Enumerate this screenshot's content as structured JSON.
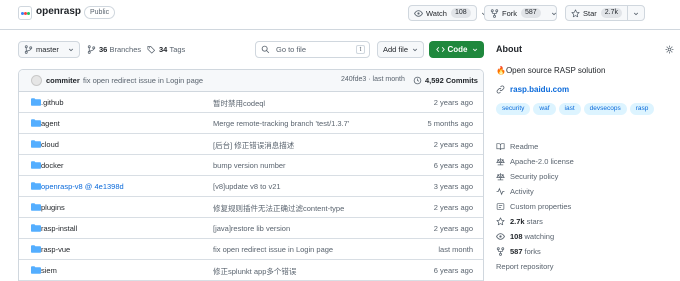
{
  "header": {
    "repo_name": "openrasp",
    "visibility": "Public",
    "watch_label": "Watch",
    "watch_count": "108",
    "fork_label": "Fork",
    "fork_count": "587",
    "star_label": "Star",
    "star_count": "2.7k"
  },
  "toolbar": {
    "branch": "master",
    "branches_count": "36",
    "branches_label": "Branches",
    "tags_count": "34",
    "tags_label": "Tags",
    "search_placeholder": "Go to file",
    "search_kbd": "t",
    "add_file_label": "Add file",
    "code_label": "Code"
  },
  "commit": {
    "author": "commiter",
    "message": "fix open redirect issue in Login page",
    "sha": "240fde3",
    "time": "last month",
    "count": "4,592 Commits"
  },
  "files": [
    {
      "name": ".github",
      "message": "暂时禁用codeql",
      "date": "2 years ago",
      "link": false
    },
    {
      "name": "agent",
      "message": "Merge remote-tracking branch 'test/1.3.7'",
      "date": "5 months ago",
      "link": false
    },
    {
      "name": "cloud",
      "message": "[后台] 修正错误消息描述",
      "date": "2 years ago",
      "link": false
    },
    {
      "name": "docker",
      "message": "bump version number",
      "date": "6 years ago",
      "link": false
    },
    {
      "name": "openrasp-v8 @ 4e1398d",
      "message": "[v8]update v8 to v21",
      "date": "3 years ago",
      "link": true
    },
    {
      "name": "plugins",
      "message": "修复规则插件无法正确过滤content-type",
      "date": "2 years ago",
      "link": false
    },
    {
      "name": "rasp-install",
      "message": "[java]restore lib version",
      "date": "2 years ago",
      "link": false
    },
    {
      "name": "rasp-vue",
      "message": "fix open redirect issue in Login page",
      "date": "last month",
      "link": false
    },
    {
      "name": "siem",
      "message": "修正splunkt app多个错误",
      "date": "6 years ago",
      "link": false
    }
  ],
  "sidebar": {
    "about_title": "About",
    "description": "🔥Open source RASP solution",
    "website": "rasp.baidu.com",
    "topics": [
      "security",
      "waf",
      "iast",
      "devsecops",
      "rasp"
    ],
    "readme": "Readme",
    "license": "Apache-2.0 license",
    "security_policy": "Security policy",
    "activity": "Activity",
    "custom_properties": "Custom properties",
    "stars_count": "2.7k",
    "stars_label": "stars",
    "watching_count": "108",
    "watching_label": "watching",
    "forks_count": "587",
    "forks_label": "forks",
    "report": "Report repository"
  },
  "colors": {
    "accent_green": "#1f883d",
    "link_blue": "#0969da",
    "folder_blue": "#54aeff"
  }
}
